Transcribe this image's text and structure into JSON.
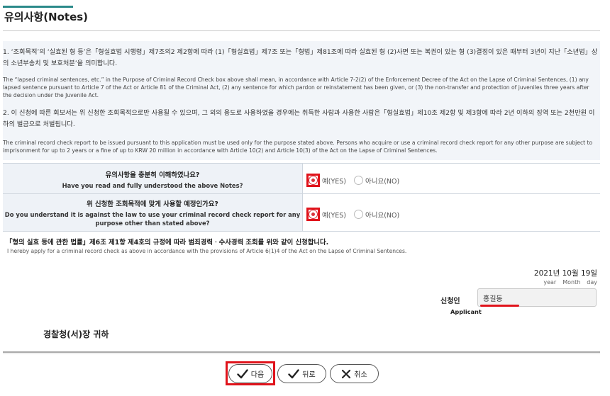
{
  "header": {
    "title": "유의사항(Notes)"
  },
  "notes": {
    "p1_ko": "1. ‘조회목적’의 ‘실효된 형 등’은「형실효법 시행령」제7조의2 제2항에 따라 (1)「형실효법」제7조 또는「형법」제81조에 따라 실효된 형 (2)사면 또는 복권이 있는 형 (3)결정이 있은 때부터 3년이 지난「소년법」상의 소년부송치 및 보호처분’을 의미합니다.",
    "p1_en": "The “lapsed criminal sentences, etc.” in the Purpose of Criminal Record Check box above shall mean, in accordance with Article 7-2(2) of the Enforcement Decree of the Act on the Lapse of Criminal Sentences, (1) any lapsed sentence pursuant to Article 7 of the Act or Article 81 of the Criminal Act, (2) any sentence for which pardon or reinstatement has been given, or (3) the non-transfer and protection of juveniles three years after the decision under the Juvenile Act.",
    "p2_ko": "2. 이 신청에 따른 회보서는 위 신청한 조회목적으로만 사용될 수 있으며, 그 외의 용도로 사용하였을 경우에는 취득한 사람과 사용한 사람은「형실효법」제10조 제2항 및 제3항에 따라 2년 이하의 징역 또는 2천만원 이하의 벌금으로 처벌됩니다.",
    "p2_en": "The criminal record check report to be issued pursuant to this application must be used only for the purpose stated above. Persons who acquire or use a criminal record check report for any other purpose are subject to imprisonment for up to 2 years or a fine of up to KRW 20 million in accordance with Article 10(2) and Article 10(3) of the Act on the Lapse of Criminal Sentences."
  },
  "questions": [
    {
      "ko": "유의사항을 충분히 이해하였나요?",
      "en": "Have you read and fully understood the above Notes?",
      "yes": "예(YES)",
      "no": "아니요(NO)",
      "selected": "yes"
    },
    {
      "ko": "위 신청한 조회목적에 맞게 사용할 예정인가요?",
      "en": "Do you understand it is against the law to use your criminal record check report for any purpose other than stated above?",
      "yes": "예(YES)",
      "no": "아니요(NO)",
      "selected": "yes"
    }
  ],
  "application": {
    "ko": "「형의 실효 등에 관한 법률」제6조 제1항 제4호의 규정에 따라 범죄경력ㆍ수사경력 조회를 위와 같이 신청합니다.",
    "en": "I hereby apply for a criminal record check as above in accordance with the provisions of Article 6(1)4 of the Act on the Lapse of Criminal Sentences."
  },
  "date": {
    "value": "2021년 10월 19일",
    "year": "year",
    "month": "Month",
    "day": "day"
  },
  "applicant": {
    "label_ko": "신청인",
    "label_en": "Applicant",
    "value": "홍길동"
  },
  "addressee": "경찰청(서)장 귀하",
  "buttons": {
    "next": "다음",
    "back": "뒤로",
    "cancel": "취소"
  },
  "colors": {
    "accent": "#2b8a8a",
    "highlight": "#e0131b",
    "radio_selected": "#d9313b"
  }
}
